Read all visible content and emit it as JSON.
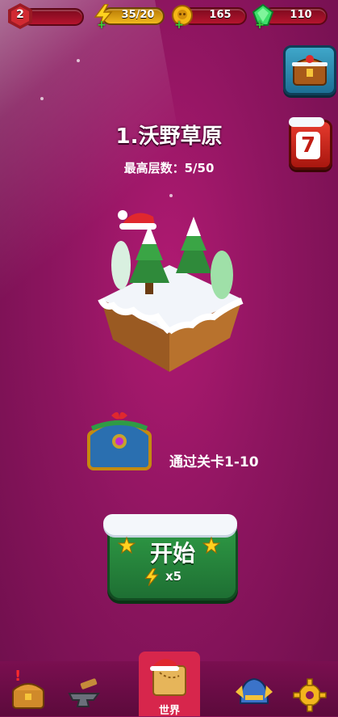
{
  "top_bar": {
    "player_level": "2",
    "energy": "35/20",
    "coins": "165",
    "gems": "110",
    "energy_icon": "lightning-icon",
    "coin_icon": "skull-coin-icon",
    "gem_icon": "green-gem-icon"
  },
  "side": {
    "shop_icon": "christmas-chest-icon",
    "calendar_number": "7"
  },
  "world": {
    "title": "1.沃野草原",
    "best_floor_label": "最高层数：5/50"
  },
  "reward": {
    "label": "通过关卡1-10"
  },
  "start_button": {
    "label": "开始",
    "cost": "x5"
  },
  "bottom_nav": {
    "items": [
      {
        "icon": "chest-icon",
        "label": ""
      },
      {
        "icon": "anvil-hammer-icon",
        "label": ""
      },
      {
        "icon": "world-map-icon",
        "label": "世界"
      },
      {
        "icon": "helmet-icon",
        "label": ""
      },
      {
        "icon": "gear-icon",
        "label": ""
      }
    ]
  },
  "colors": {
    "background": "#8e1560",
    "start_green": "#2f9b45",
    "active_tab": "#d7264c"
  }
}
